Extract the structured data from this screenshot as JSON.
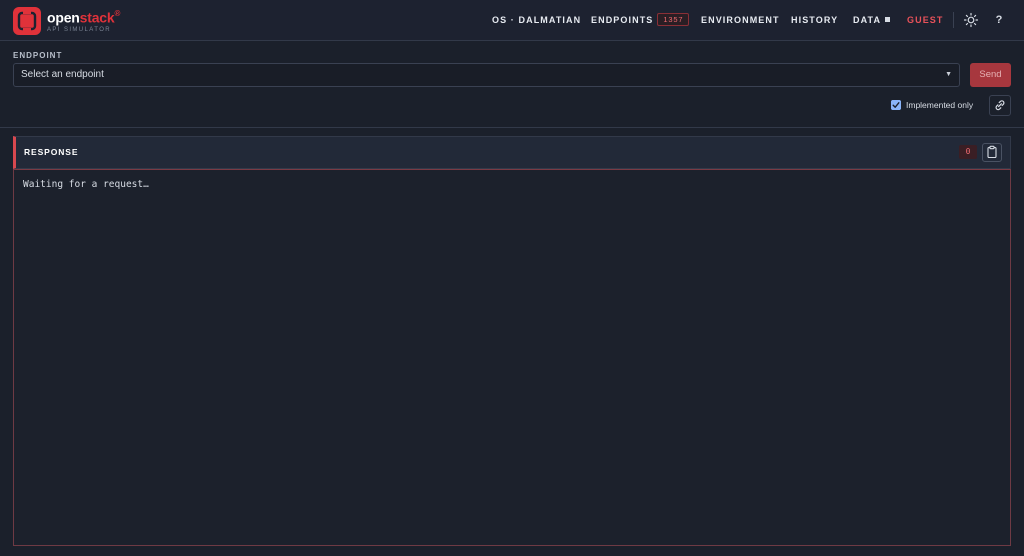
{
  "brand": {
    "name_part1": "open",
    "name_part2": "stack",
    "trademark": "®",
    "subtitle": "API SIMULATOR",
    "accent": "#e0323a"
  },
  "nav": {
    "region": "OS · DALMATIAN",
    "endpoints_label": "ENDPOINTS",
    "endpoints_count": "1357",
    "environment": "ENVIRONMENT",
    "history": "HISTORY",
    "data": "DATA",
    "guest": "GUEST",
    "theme_icon": "sun-icon",
    "help": "?"
  },
  "endpoint": {
    "label": "ENDPOINT",
    "select_value": "Select an endpoint",
    "send_label": "Send",
    "implemented_only_label": "Implemented only",
    "implemented_only_checked": true,
    "link_icon": "link-icon"
  },
  "response": {
    "title": "RESPONSE",
    "status_code": "0",
    "copy_icon": "clipboard-icon",
    "body_text": "Waiting for a request…"
  }
}
